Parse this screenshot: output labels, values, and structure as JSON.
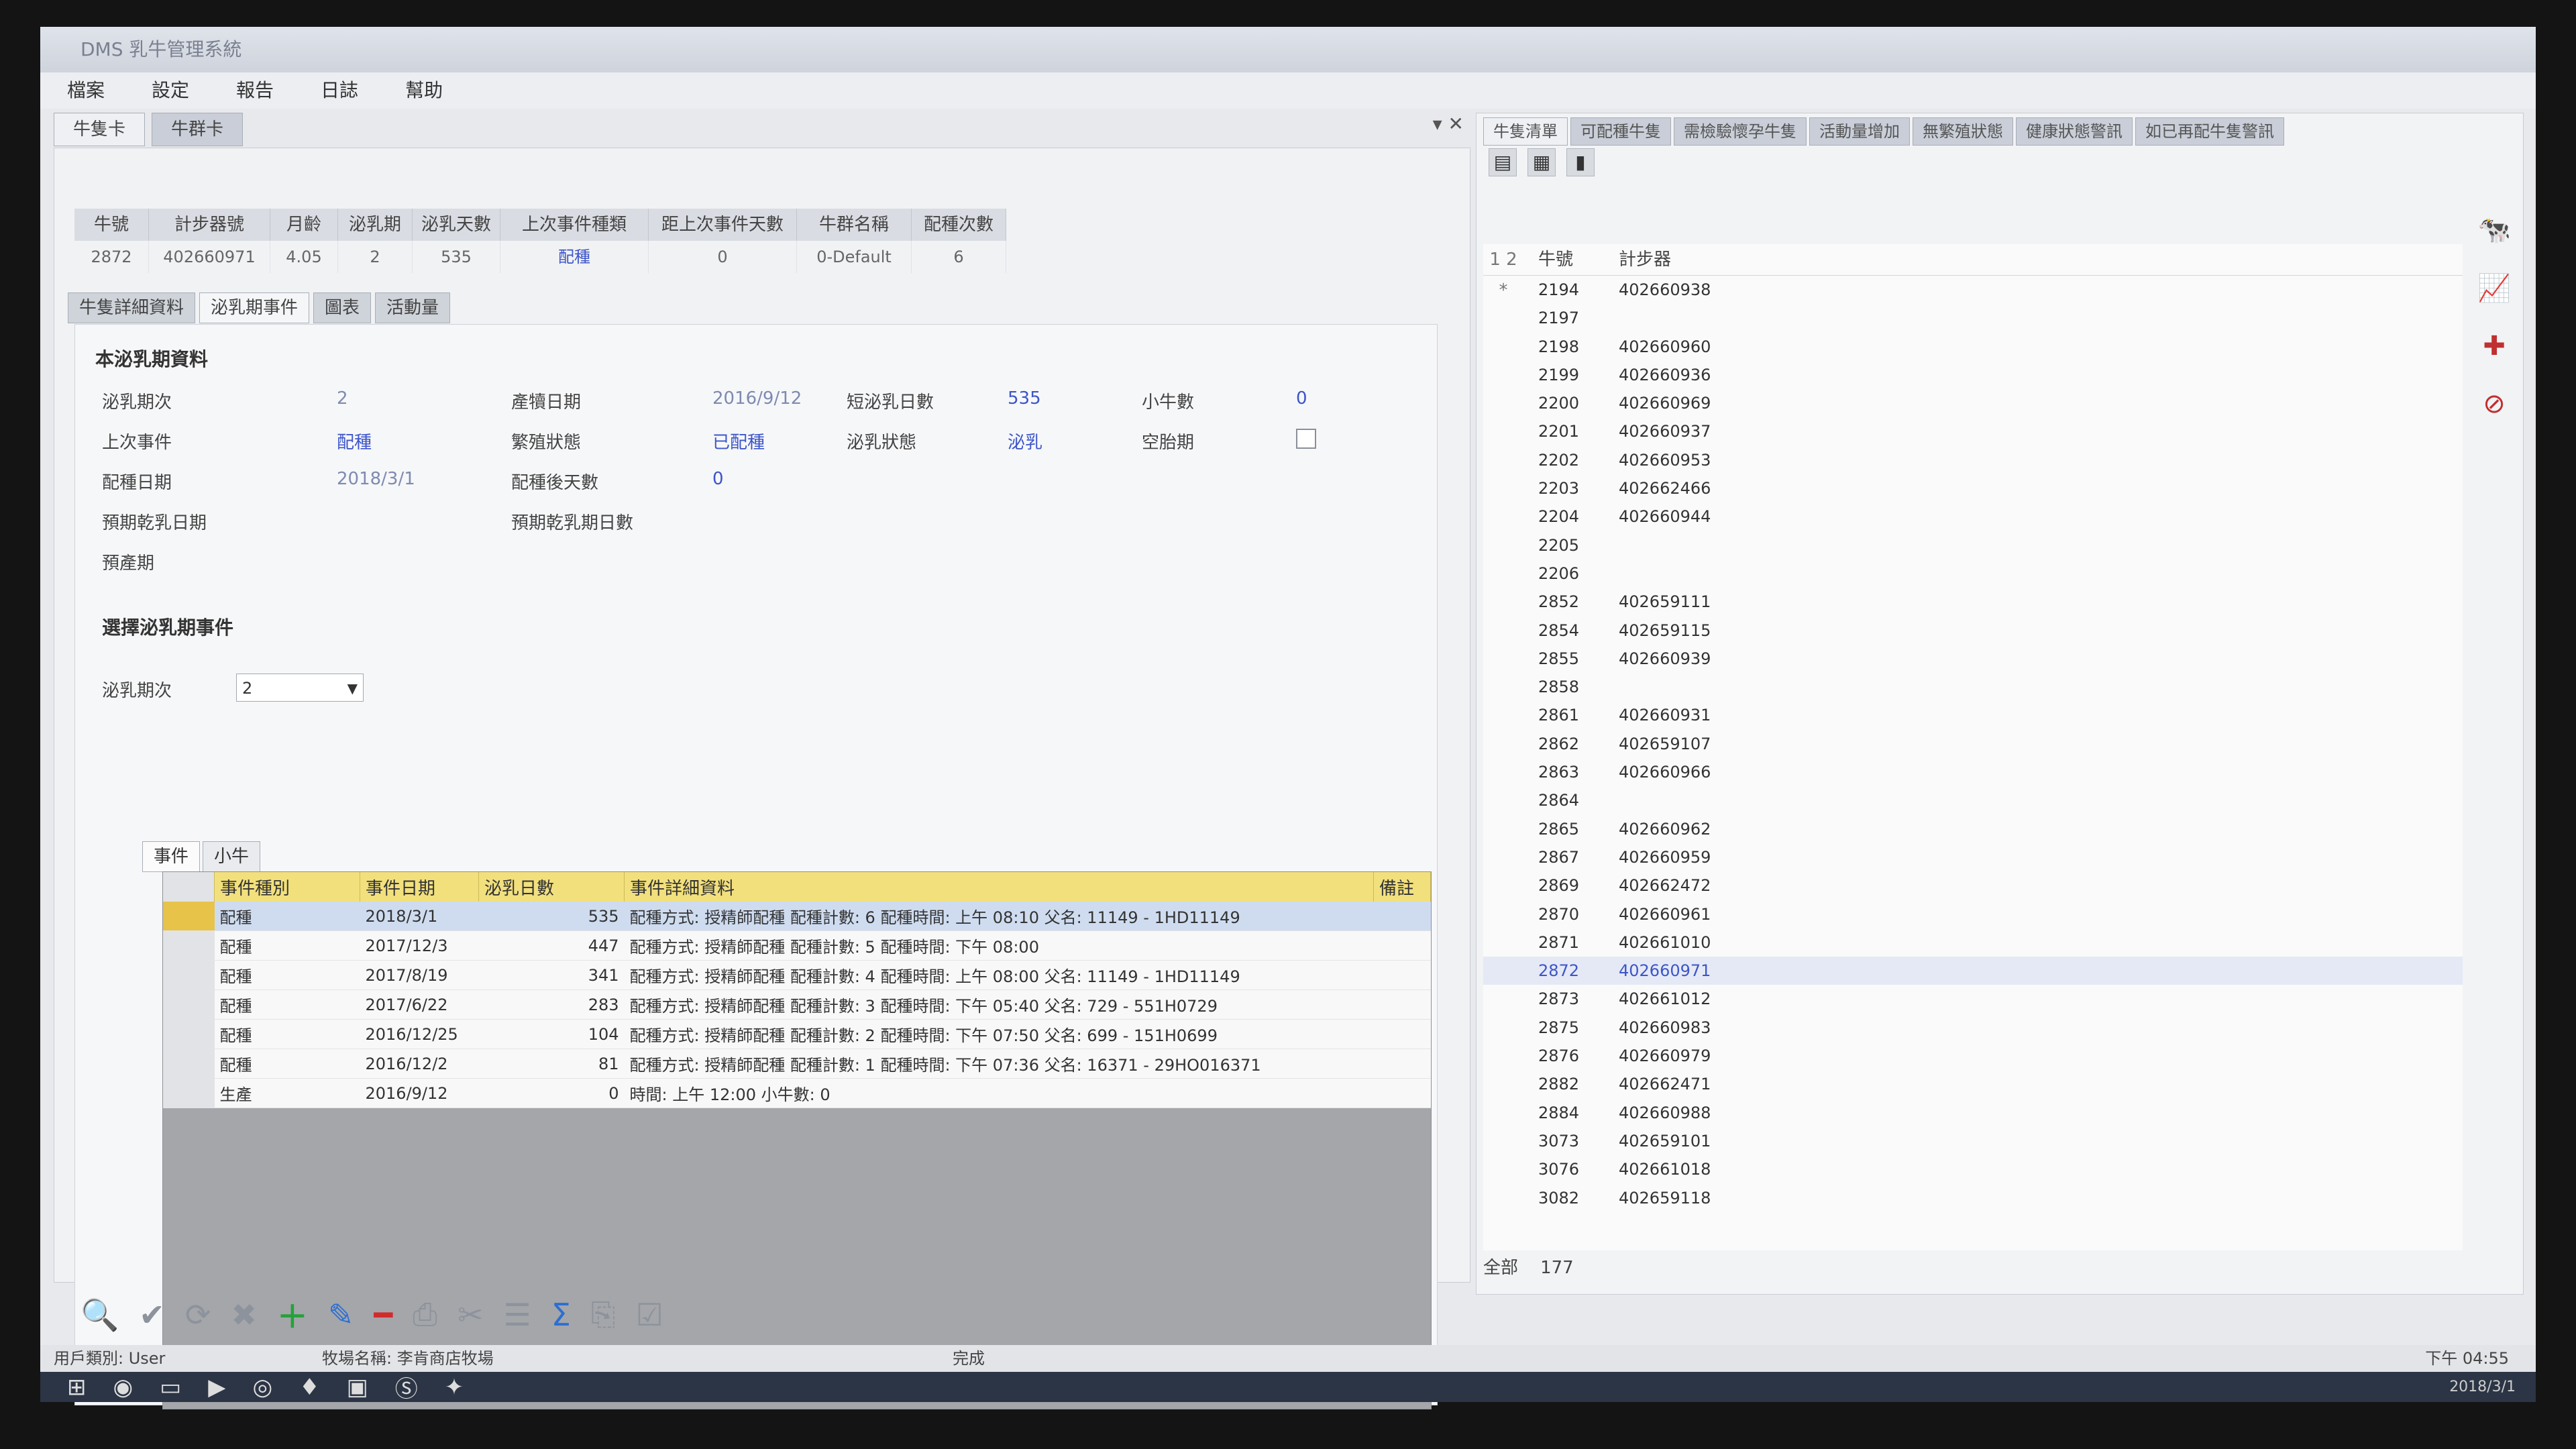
{
  "window": {
    "title": "DMS 乳牛管理系統"
  },
  "menu": [
    "檔案",
    "設定",
    "報告",
    "日誌",
    "幫助"
  ],
  "doc_tabs": [
    "牛隻卡",
    "牛群卡"
  ],
  "cow_header": {
    "columns": [
      "牛號",
      "計步器號",
      "月齡",
      "泌乳期",
      "泌乳天數",
      "上次事件種類",
      "距上次事件天數",
      "牛群名稱",
      "配種次數"
    ],
    "values": [
      "2872",
      "402660971",
      "4.05",
      "2",
      "535",
      "配種",
      "0",
      "0-Default",
      "6"
    ]
  },
  "sub_tabs": [
    "牛隻詳細資料",
    "泌乳期事件",
    "圖表",
    "活動量"
  ],
  "lactation": {
    "section_title": "本泌乳期資料",
    "lactation_no_label": "泌乳期次",
    "lactation_no": "2",
    "calving_date_label": "產犢日期",
    "calving_date": "2016/9/12",
    "short_days_label": "短泌乳日數",
    "short_days": "535",
    "calves_label": "小牛數",
    "calves": "0",
    "last_event_label": "上次事件",
    "last_event": "配種",
    "repro_label": "繁殖狀態",
    "repro": "已配種",
    "milk_status_label": "泌乳狀態",
    "milk_status": "泌乳",
    "open_label": "空胎期",
    "breeding_date_label": "配種日期",
    "breeding_date": "2018/3/1",
    "days_since_label": "配種後天數",
    "days_since": "0",
    "dry_date_label": "預期乾乳日期",
    "dry_days_label": "預期乾乳期日數",
    "due_label": "預產期"
  },
  "event_select": {
    "section_title": "選擇泌乳期事件",
    "label": "泌乳期次",
    "value": "2"
  },
  "grid_tabs": [
    "事件",
    "小牛"
  ],
  "events_table": {
    "headers": [
      "事件種別",
      "事件日期",
      "泌乳日數",
      "事件詳細資料",
      "備註"
    ],
    "rows": [
      {
        "type": "配種",
        "date": "2018/3/1",
        "days": "535",
        "detail": "配種方式: 授精師配種  配種計數: 6  配種時間: 上午 08:10  父名: 11149 - 1HD11149"
      },
      {
        "type": "配種",
        "date": "2017/12/3",
        "days": "447",
        "detail": "配種方式: 授精師配種  配種計數: 5  配種時間: 下午 08:00"
      },
      {
        "type": "配種",
        "date": "2017/8/19",
        "days": "341",
        "detail": "配種方式: 授精師配種  配種計數: 4  配種時間: 上午 08:00  父名: 11149 - 1HD11149"
      },
      {
        "type": "配種",
        "date": "2017/6/22",
        "days": "283",
        "detail": "配種方式: 授精師配種  配種計數: 3  配種時間: 下午 05:40  父名: 729 - 551H0729"
      },
      {
        "type": "配種",
        "date": "2016/12/25",
        "days": "104",
        "detail": "配種方式: 授精師配種  配種計數: 2  配種時間: 下午 07:50  父名: 699 - 151H0699"
      },
      {
        "type": "配種",
        "date": "2016/12/2",
        "days": "81",
        "detail": "配種方式: 授精師配種  配種計數: 1  配種時間: 下午 07:36  父名: 16371 - 29HO016371"
      },
      {
        "type": "生產",
        "date": "2016/9/12",
        "days": "0",
        "detail": "時間: 上午 12:00  小牛數: 0"
      }
    ]
  },
  "right_tabs": [
    "牛隻清單",
    "可配種牛隻",
    "需檢驗懷孕牛隻",
    "活動量增加",
    "無繁殖狀態",
    "健康狀態警訊",
    "如已再配牛隻警訊"
  ],
  "cow_list": {
    "headers": [
      "1 2 *",
      "牛號",
      "計步器"
    ],
    "rows": [
      [
        "2194",
        "402660938"
      ],
      [
        "2197",
        ""
      ],
      [
        "2198",
        "402660960"
      ],
      [
        "2199",
        "402660936"
      ],
      [
        "2200",
        "402660969"
      ],
      [
        "2201",
        "402660937"
      ],
      [
        "2202",
        "402660953"
      ],
      [
        "2203",
        "402662466"
      ],
      [
        "2204",
        "402660944"
      ],
      [
        "2205",
        ""
      ],
      [
        "2206",
        ""
      ],
      [
        "2852",
        "402659111"
      ],
      [
        "2854",
        "402659115"
      ],
      [
        "2855",
        "402660939"
      ],
      [
        "2858",
        ""
      ],
      [
        "2861",
        "402660931"
      ],
      [
        "2862",
        "402659107"
      ],
      [
        "2863",
        "402660966"
      ],
      [
        "2864",
        ""
      ],
      [
        "2865",
        "402660962"
      ],
      [
        "2867",
        "402660959"
      ],
      [
        "2869",
        "402662472"
      ],
      [
        "2870",
        "402660961"
      ],
      [
        "2871",
        "402661010"
      ],
      [
        "2872",
        "402660971"
      ],
      [
        "2873",
        "402661012"
      ],
      [
        "2875",
        "402660983"
      ],
      [
        "2876",
        "402660979"
      ],
      [
        "2882",
        "402662471"
      ],
      [
        "2884",
        "402660988"
      ],
      [
        "3073",
        "402659101"
      ],
      [
        "3076",
        "402661018"
      ],
      [
        "3082",
        "402659118"
      ]
    ],
    "selected": "2872",
    "total_label": "全部",
    "total": "177"
  },
  "statusbar": {
    "user": "用戶類別: User",
    "farm": "牧場名稱: 李肯商店牧場",
    "status": "完成",
    "time": "下午 04:55",
    "date": "2018/3/1"
  }
}
